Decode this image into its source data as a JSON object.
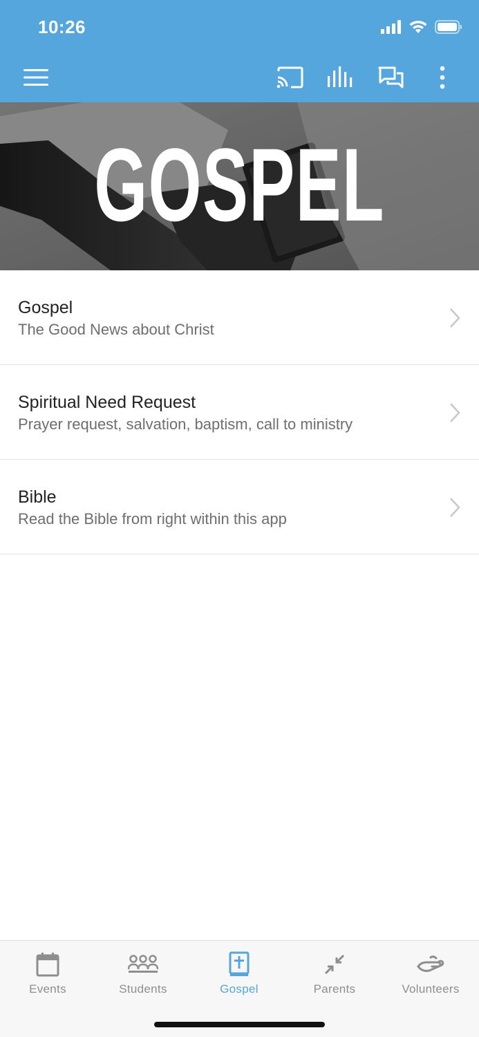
{
  "status_bar": {
    "time": "10:26"
  },
  "header": {
    "menu_icon": "hamburger-icon",
    "actions": [
      "cast-icon",
      "audio-bars-icon",
      "chat-icon",
      "more-vertical-icon"
    ],
    "accent_color": "#55A6DC"
  },
  "hero": {
    "title": "GOSPEL"
  },
  "list": {
    "items": [
      {
        "title": "Gospel",
        "subtitle": "The Good News about Christ"
      },
      {
        "title": "Spiritual Need Request",
        "subtitle": "Prayer request, salvation, baptism, call to ministry"
      },
      {
        "title": "Bible",
        "subtitle": "Read the Bible from right within this app"
      }
    ]
  },
  "tabs": [
    {
      "label": "Events",
      "icon": "calendar-icon",
      "active": false
    },
    {
      "label": "Students",
      "icon": "group-icon",
      "active": false
    },
    {
      "label": "Gospel",
      "icon": "bible-icon",
      "active": true
    },
    {
      "label": "Parents",
      "icon": "arrows-icon",
      "active": false
    },
    {
      "label": "Volunteers",
      "icon": "helping-hand-icon",
      "active": false
    }
  ]
}
